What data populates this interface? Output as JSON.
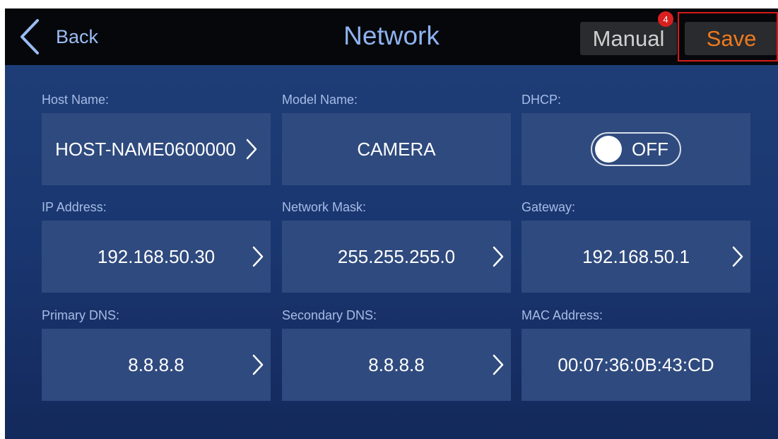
{
  "header": {
    "back_label": "Back",
    "title": "Network",
    "manual_label": "Manual",
    "manual_badge": "4",
    "save_label": "Save"
  },
  "colors": {
    "accent_save": "#ee7a1f",
    "highlight_border": "#d61a1a",
    "badge": "#d82020",
    "title": "#8fb3ef"
  },
  "fields": {
    "host_name": {
      "label": "Host Name:",
      "value": "HOST-NAME0600000"
    },
    "model_name": {
      "label": "Model Name:",
      "value": "CAMERA"
    },
    "dhcp": {
      "label": "DHCP:",
      "value": "OFF"
    },
    "ip_address": {
      "label": "IP Address:",
      "value": "192.168.50.30"
    },
    "network_mask": {
      "label": "Network Mask:",
      "value": "255.255.255.0"
    },
    "gateway": {
      "label": "Gateway:",
      "value": "192.168.50.1"
    },
    "primary_dns": {
      "label": "Primary DNS:",
      "value": "8.8.8.8"
    },
    "secondary_dns": {
      "label": "Secondary DNS:",
      "value": "8.8.8.8"
    },
    "mac_address": {
      "label": "MAC Address:",
      "value": "00:07:36:0B:43:CD"
    }
  }
}
